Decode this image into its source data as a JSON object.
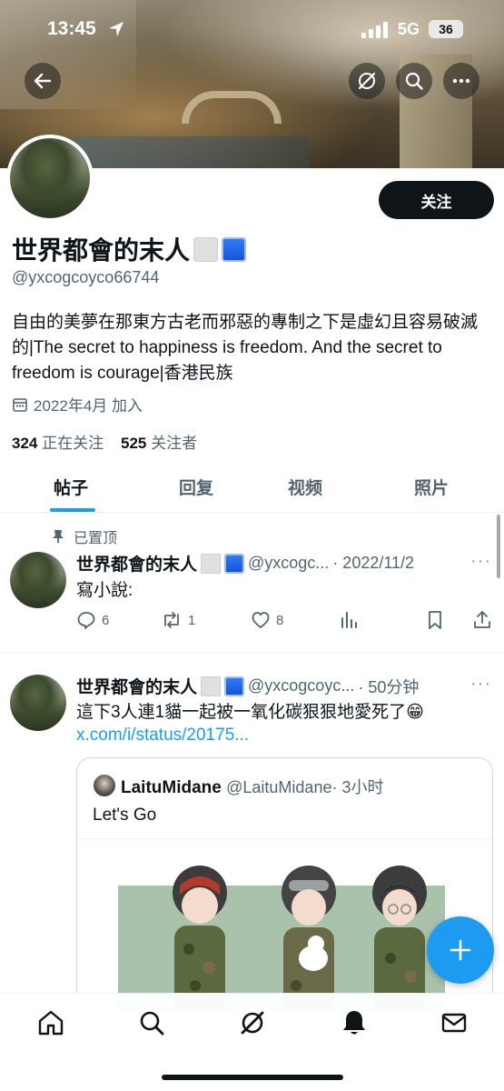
{
  "status": {
    "time": "13:45",
    "network": "5G",
    "battery": "36"
  },
  "header": {
    "back_label": "back",
    "icons": [
      "back-arrow-icon",
      "grok-icon",
      "search-icon",
      "more-icon"
    ]
  },
  "profile": {
    "display_name": "世界都會的末人",
    "handle": "@yxcogcoyco66744",
    "bio": "自由的美夢在那東方古老而邪惡的專制之下是虛幻且容易破滅的|The secret to happiness is freedom. And the secret to freedom is courage|香港民族",
    "joined": "2022年4月 加入",
    "following_count": "324",
    "following_label": "正在关注",
    "followers_count": "525",
    "followers_label": "关注者",
    "follow_button": "关注"
  },
  "tabs": [
    {
      "label": "帖子",
      "active": true
    },
    {
      "label": "回复",
      "active": false
    },
    {
      "label": "视频",
      "active": false
    },
    {
      "label": "照片",
      "active": false
    }
  ],
  "posts": [
    {
      "pinned_label": "已置顶",
      "name": "世界都會的末人",
      "handle": "@yxcogc...",
      "time": "· 2022/11/2",
      "text": "寫小說:",
      "replies": "6",
      "reposts": "1",
      "likes": "8"
    },
    {
      "name": "世界都會的末人",
      "handle": "@yxcogcoyc...",
      "time": "· 50分钟",
      "text": "這下3人連1貓一起被一氧化碳狠狠地愛死了😁",
      "link": "x.com/i/status/20175...",
      "quote": {
        "name": "LaituMidane",
        "handle": "@LaituMidane",
        "time": "· 3小时",
        "text": "Let's Go"
      }
    }
  ],
  "nav": [
    "home-icon",
    "search-icon",
    "grok-icon",
    "notifications-icon",
    "messages-icon"
  ],
  "colors": {
    "accent": "#1d9bf0",
    "text": "#0f1419",
    "secondary": "#536471"
  }
}
